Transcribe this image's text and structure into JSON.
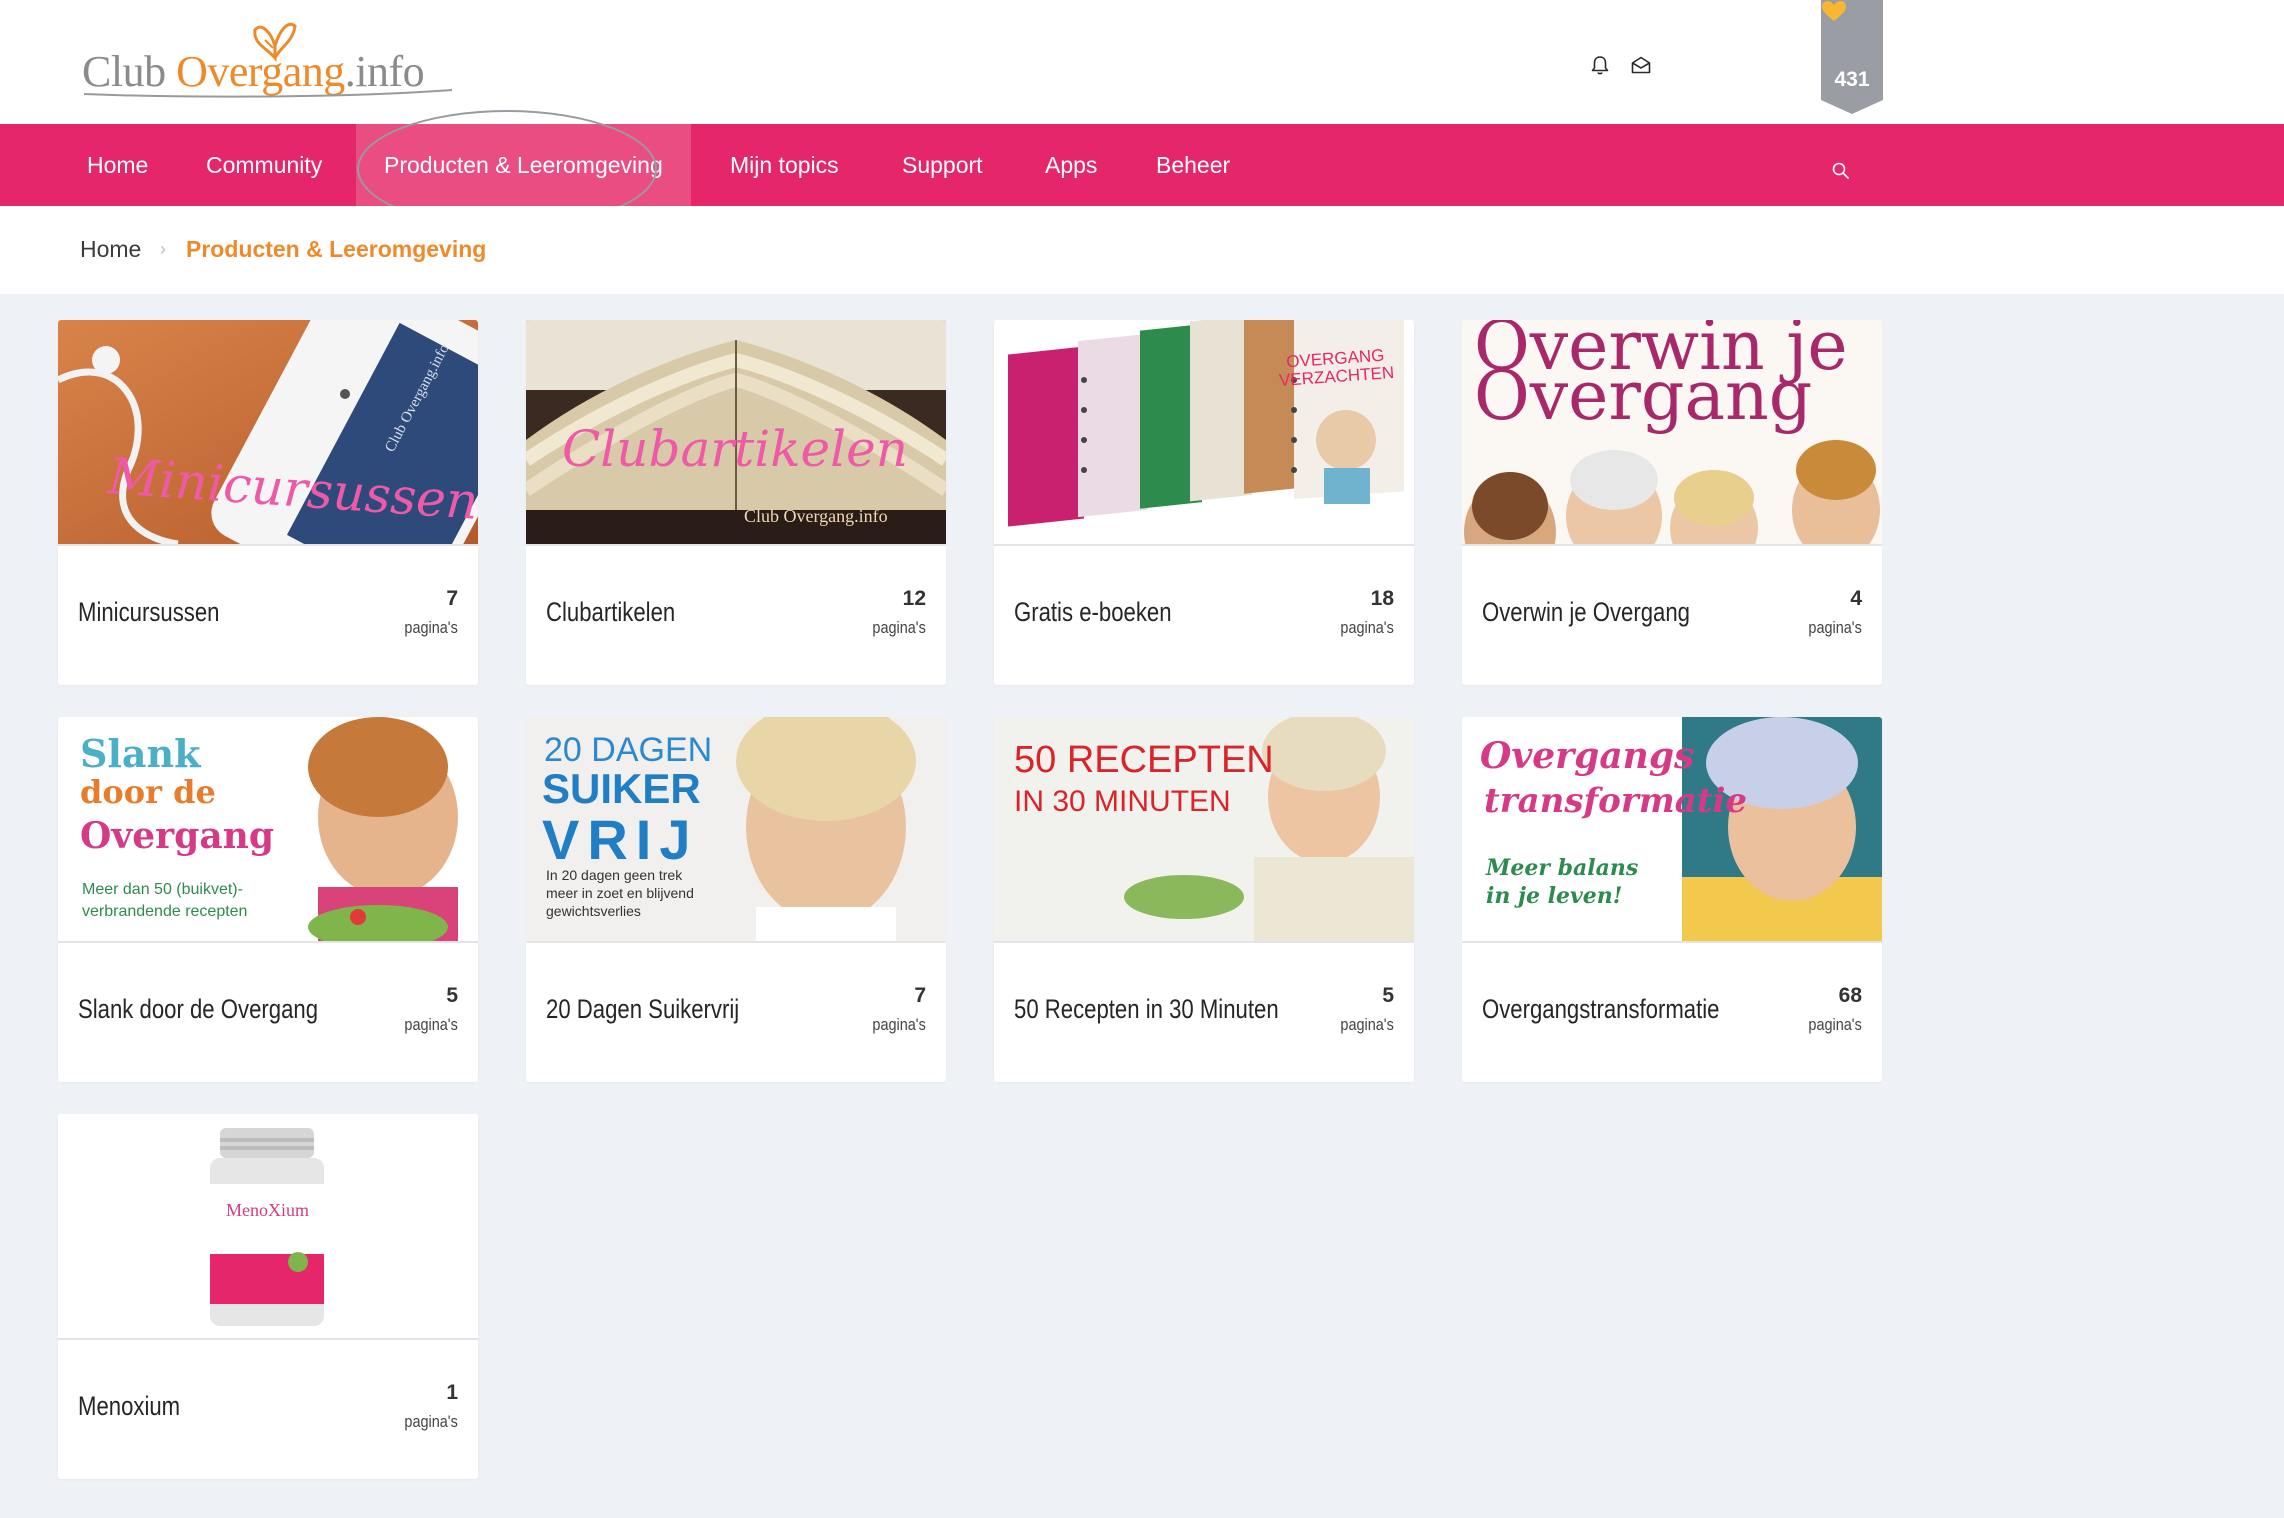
{
  "logo": {
    "part1": "Club ",
    "part2": "Overgang",
    "part3": ".info"
  },
  "header": {
    "icons": [
      "bell-icon",
      "mail-icon"
    ],
    "likes_count": "431",
    "likes_icon": "heart-icon"
  },
  "nav": {
    "items": [
      {
        "label": "Home"
      },
      {
        "label": "Community"
      },
      {
        "label": "Producten & Leeromgeving"
      },
      {
        "label": "Mijn topics"
      },
      {
        "label": "Support"
      },
      {
        "label": "Apps"
      },
      {
        "label": "Beheer"
      }
    ],
    "active_index": 2,
    "search_icon": "search-icon"
  },
  "breadcrumb": {
    "home": "Home",
    "separator": "›",
    "current": "Producten & Leeromgeving"
  },
  "cards": [
    {
      "title": "Minicursussen",
      "count": "7",
      "unit": "pagina's",
      "image_text": "Minicursussen",
      "image_caption": "Club Overgang.info"
    },
    {
      "title": "Clubartikelen",
      "count": "12",
      "unit": "pagina's",
      "image_text": "Clubartikelen",
      "image_caption": "Club Overgang.info"
    },
    {
      "title": "Gratis e-boeken",
      "count": "18",
      "unit": "pagina's",
      "image_text": "OVERGANG VERZACHTEN"
    },
    {
      "title": "Overwin je Overgang",
      "count": "4",
      "unit": "pagina's",
      "image_line1": "Overwin je",
      "image_line2": "Overgang"
    },
    {
      "title": "Slank door de Overgang",
      "count": "5",
      "unit": "pagina's",
      "image_line1": "Slank",
      "image_line2": "door de",
      "image_line3": "Overgang",
      "image_sub1": "Meer dan 50 (buikvet)-",
      "image_sub2": "verbrandende recepten"
    },
    {
      "title": "20 Dagen Suikervrij",
      "count": "7",
      "unit": "pagina's",
      "image_line1": "20 DAGEN",
      "image_line2": "SUIKER",
      "image_line3": "VRIJ",
      "image_sub1": "In 20 dagen geen trek",
      "image_sub2": "meer in zoet en blijvend",
      "image_sub3": "gewichtsverlies"
    },
    {
      "title": "50 Recepten in 30 Minuten",
      "count": "5",
      "unit": "pagina's",
      "image_line1": "50 RECEPTEN",
      "image_line2": "IN 30 MINUTEN"
    },
    {
      "title": "Overgangstransformatie",
      "count": "68",
      "unit": "pagina's",
      "image_line1": "Overgangs",
      "image_line2": "transformatie",
      "image_sub1": "Meer balans",
      "image_sub2": "in je leven!"
    },
    {
      "title": "Menoxium",
      "count": "1",
      "unit": "pagina's",
      "image_text": "MenoXium"
    }
  ],
  "colors": {
    "brand_pink": "#e6266a",
    "brand_orange": "#ef8a2a",
    "page_bg": "#eef1f5"
  }
}
